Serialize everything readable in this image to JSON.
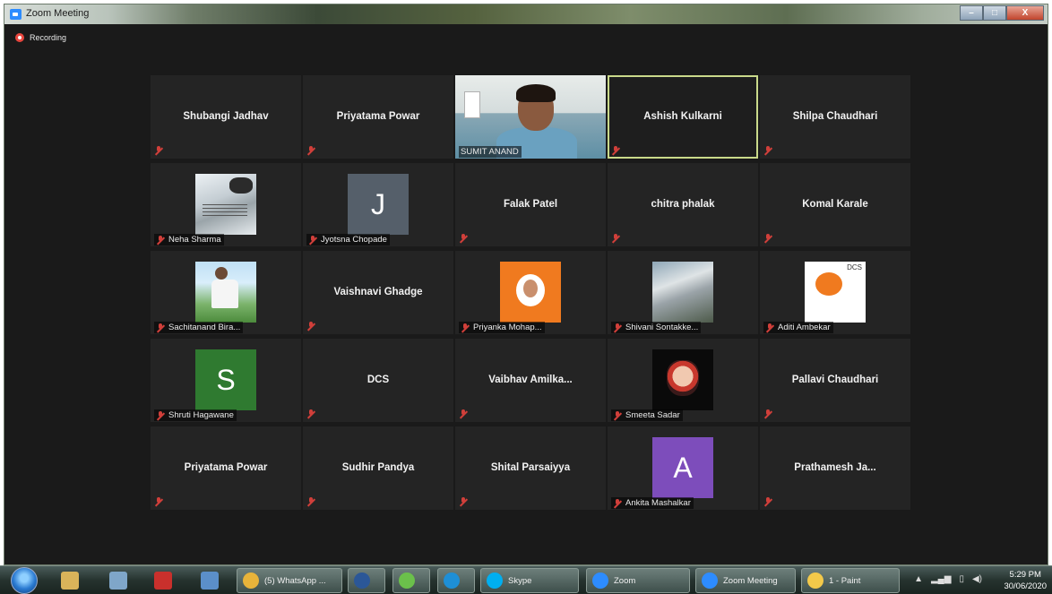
{
  "window": {
    "title": "Zoom Meeting",
    "controls": [
      "–",
      "□",
      "X"
    ]
  },
  "recording": {
    "label": "Recording"
  },
  "tiles": [
    {
      "kind": "name",
      "name": "Shubangi Jadhav"
    },
    {
      "kind": "name",
      "name": "Priyatama Powar"
    },
    {
      "kind": "video",
      "name": "SUMIT ANAND"
    },
    {
      "kind": "name",
      "name": "Ashish Kulkarni",
      "active": true
    },
    {
      "kind": "name",
      "name": "Shilpa Chaudhari"
    },
    {
      "kind": "photo",
      "name": "Neha Sharma",
      "photo": "photo-snow"
    },
    {
      "kind": "avatar",
      "name": "Jyotsna Chopade",
      "letter": "J",
      "color": "av-gray"
    },
    {
      "kind": "name",
      "name": "Falak Patel"
    },
    {
      "kind": "name",
      "name": "chitra phalak"
    },
    {
      "kind": "name",
      "name": "Komal Karale"
    },
    {
      "kind": "photo",
      "name": "Sachitanand Bira...",
      "photo": "photo-park"
    },
    {
      "kind": "name",
      "name": "Vaishnavi Ghadge"
    },
    {
      "kind": "photo",
      "name": "Priyanka Mohap...",
      "photo": "photo-orange"
    },
    {
      "kind": "photo",
      "name": "Shivani Sontakke...",
      "photo": "photo-sky"
    },
    {
      "kind": "photo",
      "name": "Aditi Ambekar",
      "photo": "photo-doc"
    },
    {
      "kind": "avatar",
      "name": "Shruti Hagawane",
      "letter": "S",
      "color": "av-green"
    },
    {
      "kind": "name",
      "name": "DCS"
    },
    {
      "kind": "name",
      "name": "Vaibhav  Amilka..."
    },
    {
      "kind": "photo",
      "name": "Smeeta Sadar",
      "photo": "photo-dark"
    },
    {
      "kind": "name",
      "name": "Pallavi Chaudhari"
    },
    {
      "kind": "name",
      "name": "Priyatama Powar"
    },
    {
      "kind": "name",
      "name": "Sudhir Pandya"
    },
    {
      "kind": "name",
      "name": "Shital Parsaiyya"
    },
    {
      "kind": "avatar",
      "name": "Ankita Mashalkar",
      "letter": "A",
      "color": "av-purple"
    },
    {
      "kind": "name",
      "name": "Prathamesh  Ja..."
    }
  ],
  "taskbar": {
    "pinned": [
      {
        "name": "explorer-icon",
        "color": "#d9b35a"
      },
      {
        "name": "calculator-icon",
        "color": "#7fa6c9"
      },
      {
        "name": "acrobat-icon",
        "color": "#c9302c"
      },
      {
        "name": "notepad-icon",
        "color": "#5b8fc9"
      }
    ],
    "tasks": [
      {
        "name": "chrome",
        "label": "(5) WhatsApp ...",
        "color": "#e8b33a"
      },
      {
        "name": "word",
        "label": "",
        "color": "#2b5797"
      },
      {
        "name": "app",
        "label": "",
        "color": "#6bc04b"
      },
      {
        "name": "edge",
        "label": "",
        "color": "#1e8fd6"
      },
      {
        "name": "skype",
        "label": "Skype",
        "color": "#00aff0"
      },
      {
        "name": "zoom",
        "label": "Zoom",
        "color": "#2d8cff"
      },
      {
        "name": "zoom-meeting",
        "label": "Zoom Meeting",
        "color": "#2d8cff"
      },
      {
        "name": "paint",
        "label": "1 - Paint",
        "color": "#f3c94a"
      }
    ],
    "tray": [
      "▲",
      "signal",
      "battery",
      "volume"
    ],
    "time": "5:29 PM",
    "date": "30/06/2020"
  }
}
